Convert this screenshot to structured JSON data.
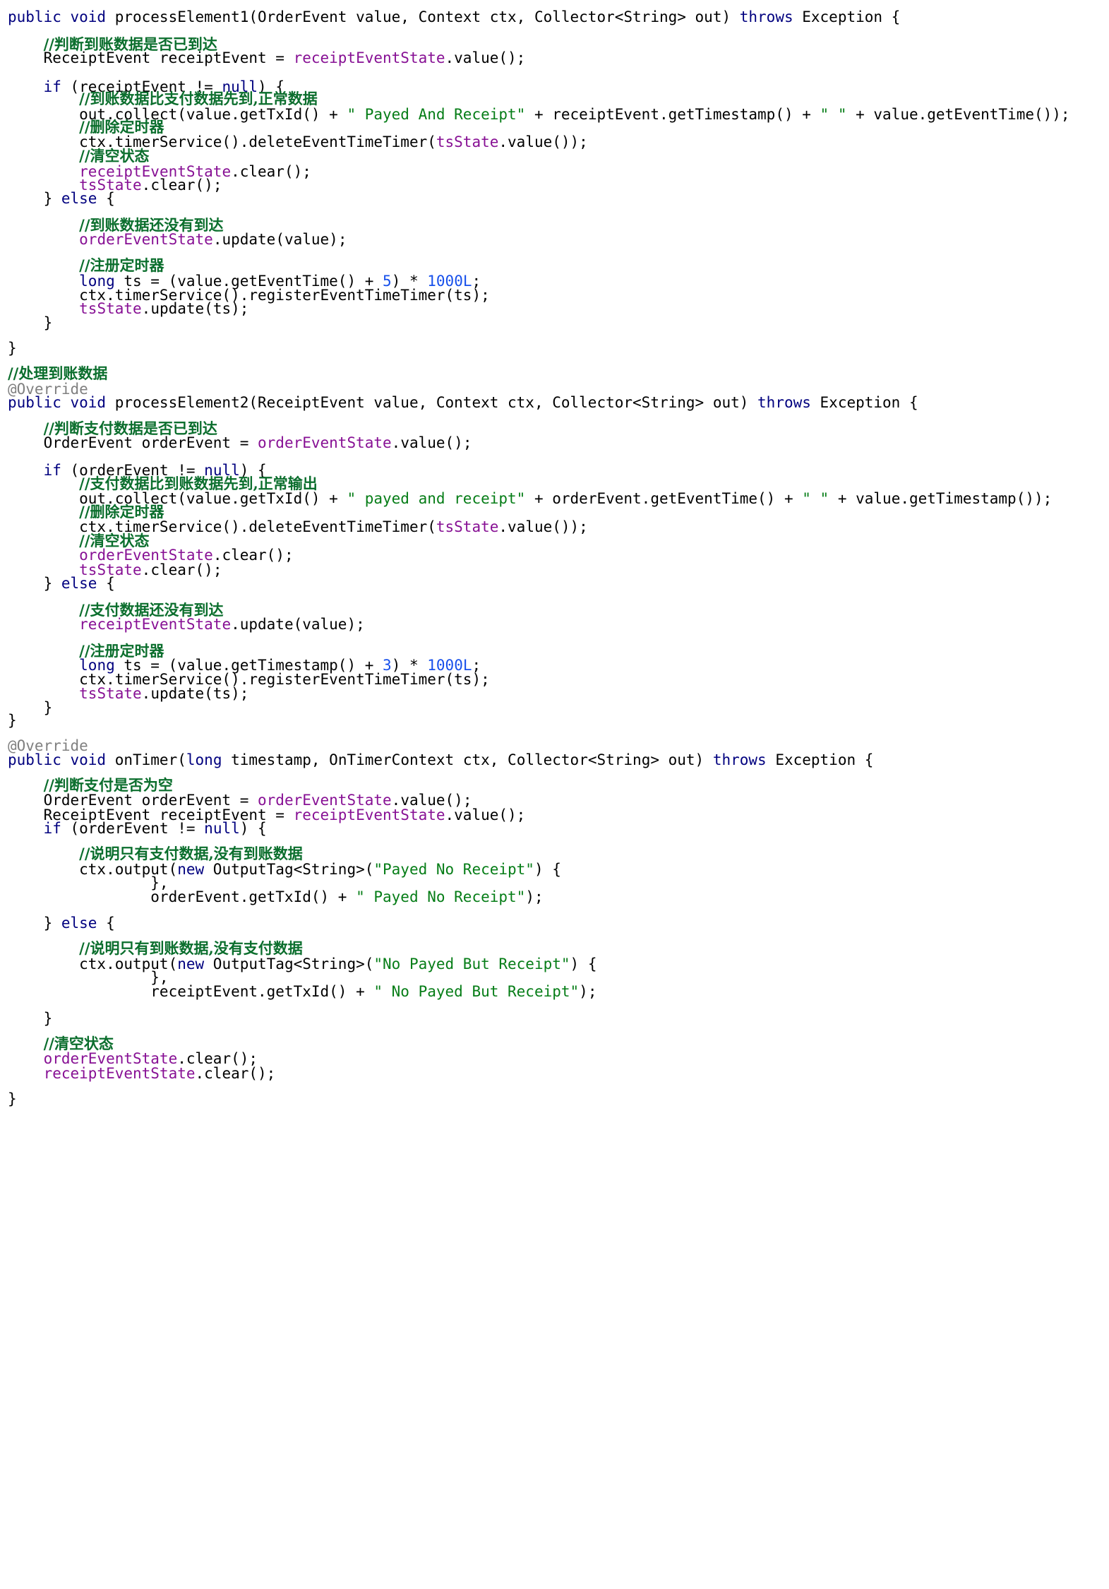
{
  "editor": {
    "palette": {
      "background": "#ffffff",
      "text": "#000000",
      "keyword": "#00007f",
      "literal": "#1750eb",
      "field": "#871094",
      "string": "#067d17",
      "comment": "#0b6e2d",
      "annotation": "#808080"
    },
    "lines": [
      [
        {
          "t": "public void ",
          "c": "kw"
        },
        {
          "t": "processElement1",
          "c": "fn"
        },
        {
          "t": "(OrderEvent value, Context ctx, Collector<String> out) "
        },
        {
          "t": "throws",
          "c": "kw"
        },
        {
          "t": " Exception {"
        }
      ],
      [
        {
          "t": "    "
        },
        {
          "t": "//判断到账数据是否已到达",
          "c": "cmt"
        }
      ],
      [
        {
          "t": "    ReceiptEvent receiptEvent = "
        },
        {
          "t": "receiptEventState",
          "c": "fld"
        },
        {
          "t": ".value();"
        }
      ],
      [
        {
          "t": "    "
        },
        {
          "t": "if",
          "c": "kw"
        },
        {
          "t": " (receiptEvent != "
        },
        {
          "t": "null",
          "c": "kw"
        },
        {
          "t": ") {"
        }
      ],
      [
        {
          "t": "        "
        },
        {
          "t": "//到账数据比支付数据先到,正常数据",
          "c": "cmt"
        }
      ],
      [
        {
          "t": "        out.collect(value.getTxId() + "
        },
        {
          "t": "\" Payed And Receipt\"",
          "c": "str"
        },
        {
          "t": " + receiptEvent.getTimestamp() + "
        },
        {
          "t": "\" \"",
          "c": "str"
        },
        {
          "t": " + value.getEventTime());"
        }
      ],
      [
        {
          "t": "        "
        },
        {
          "t": "//删除定时器",
          "c": "cmt"
        }
      ],
      [
        {
          "t": "        ctx.timerService().deleteEventTimeTimer("
        },
        {
          "t": "tsState",
          "c": "fld"
        },
        {
          "t": ".value());"
        }
      ],
      [
        {
          "t": "        "
        },
        {
          "t": "//清空状态",
          "c": "cmt"
        }
      ],
      [
        {
          "t": "        "
        },
        {
          "t": "receiptEventState",
          "c": "fld"
        },
        {
          "t": ".clear();"
        }
      ],
      [
        {
          "t": "        "
        },
        {
          "t": "tsState",
          "c": "fld"
        },
        {
          "t": ".clear();"
        }
      ],
      [
        {
          "t": "    } "
        },
        {
          "t": "else",
          "c": "kw"
        },
        {
          "t": " {"
        }
      ],
      [
        {
          "t": "        "
        },
        {
          "t": "//到账数据还没有到达",
          "c": "cmt"
        }
      ],
      [
        {
          "t": "        "
        },
        {
          "t": "orderEventState",
          "c": "fld"
        },
        {
          "t": ".update(value);"
        }
      ],
      [
        {
          "t": "        "
        },
        {
          "t": "//注册定时器",
          "c": "cmt"
        }
      ],
      [
        {
          "t": "        "
        },
        {
          "t": "long",
          "c": "kw"
        },
        {
          "t": " ts = (value.getEventTime() + "
        },
        {
          "t": "5",
          "c": "lit"
        },
        {
          "t": ") * "
        },
        {
          "t": "1000L",
          "c": "lit"
        },
        {
          "t": ";"
        }
      ],
      [
        {
          "t": "        ctx.timerService().registerEventTimeTimer(ts);"
        }
      ],
      [
        {
          "t": "        "
        },
        {
          "t": "tsState",
          "c": "fld"
        },
        {
          "t": ".update(ts);"
        }
      ],
      [
        {
          "t": "    }"
        }
      ],
      [
        {
          "t": "}"
        }
      ],
      [
        {
          "t": "//处理到账数据",
          "c": "cmt"
        }
      ],
      [
        {
          "t": "@Override",
          "c": "ann"
        }
      ],
      [
        {
          "t": "public void ",
          "c": "kw"
        },
        {
          "t": "processElement2",
          "c": "fn"
        },
        {
          "t": "(ReceiptEvent value, Context ctx, Collector<String> out) "
        },
        {
          "t": "throws",
          "c": "kw"
        },
        {
          "t": " Exception {"
        }
      ],
      [
        {
          "t": "    "
        },
        {
          "t": "//判断支付数据是否已到达",
          "c": "cmt"
        }
      ],
      [
        {
          "t": "    OrderEvent orderEvent = "
        },
        {
          "t": "orderEventState",
          "c": "fld"
        },
        {
          "t": ".value();"
        }
      ],
      [
        {
          "t": "    "
        },
        {
          "t": "if",
          "c": "kw"
        },
        {
          "t": " (orderEvent != "
        },
        {
          "t": "null",
          "c": "kw"
        },
        {
          "t": ") {"
        }
      ],
      [
        {
          "t": "        "
        },
        {
          "t": "//支付数据比到账数据先到,正常输出",
          "c": "cmt"
        }
      ],
      [
        {
          "t": "        out.collect(value.getTxId() + "
        },
        {
          "t": "\" payed and receipt\"",
          "c": "str"
        },
        {
          "t": " + orderEvent.getEventTime() + "
        },
        {
          "t": "\" \"",
          "c": "str"
        },
        {
          "t": " + value.getTimestamp());"
        }
      ],
      [
        {
          "t": "        "
        },
        {
          "t": "//删除定时器",
          "c": "cmt"
        }
      ],
      [
        {
          "t": "        ctx.timerService().deleteEventTimeTimer("
        },
        {
          "t": "tsState",
          "c": "fld"
        },
        {
          "t": ".value());"
        }
      ],
      [
        {
          "t": "        "
        },
        {
          "t": "//清空状态",
          "c": "cmt"
        }
      ],
      [
        {
          "t": "        "
        },
        {
          "t": "orderEventState",
          "c": "fld"
        },
        {
          "t": ".clear();"
        }
      ],
      [
        {
          "t": "        "
        },
        {
          "t": "tsState",
          "c": "fld"
        },
        {
          "t": ".clear();"
        }
      ],
      [
        {
          "t": "    } "
        },
        {
          "t": "else",
          "c": "kw"
        },
        {
          "t": " {"
        }
      ],
      [
        {
          "t": "        "
        },
        {
          "t": "//支付数据还没有到达",
          "c": "cmt"
        }
      ],
      [
        {
          "t": "        "
        },
        {
          "t": "receiptEventState",
          "c": "fld"
        },
        {
          "t": ".update(value);"
        }
      ],
      [
        {
          "t": "        "
        },
        {
          "t": "//注册定时器",
          "c": "cmt"
        }
      ],
      [
        {
          "t": "        "
        },
        {
          "t": "long",
          "c": "kw"
        },
        {
          "t": " ts = (value.getTimestamp() + "
        },
        {
          "t": "3",
          "c": "lit"
        },
        {
          "t": ") * "
        },
        {
          "t": "1000L",
          "c": "lit"
        },
        {
          "t": ";"
        }
      ],
      [
        {
          "t": "        ctx.timerService().registerEventTimeTimer(ts);"
        }
      ],
      [
        {
          "t": "        "
        },
        {
          "t": "tsState",
          "c": "fld"
        },
        {
          "t": ".update(ts);"
        }
      ],
      [
        {
          "t": "    }"
        }
      ],
      [
        {
          "t": "}"
        }
      ],
      [
        {
          "t": "@Override",
          "c": "ann"
        }
      ],
      [
        {
          "t": "public void ",
          "c": "kw"
        },
        {
          "t": "onTimer",
          "c": "fn"
        },
        {
          "t": "("
        },
        {
          "t": "long",
          "c": "kw"
        },
        {
          "t": " timestamp, OnTimerContext ctx, Collector<String> out) "
        },
        {
          "t": "throws",
          "c": "kw"
        },
        {
          "t": " Exception {"
        }
      ],
      [
        {
          "t": "    "
        },
        {
          "t": "//判断支付是否为空",
          "c": "cmt"
        }
      ],
      [
        {
          "t": "    OrderEvent orderEvent = "
        },
        {
          "t": "orderEventState",
          "c": "fld"
        },
        {
          "t": ".value();"
        }
      ],
      [
        {
          "t": "    ReceiptEvent receiptEvent = "
        },
        {
          "t": "receiptEventState",
          "c": "fld"
        },
        {
          "t": ".value();"
        }
      ],
      [
        {
          "t": "    "
        },
        {
          "t": "if",
          "c": "kw"
        },
        {
          "t": " (orderEvent != "
        },
        {
          "t": "null",
          "c": "kw"
        },
        {
          "t": ") {"
        }
      ],
      [
        {
          "t": "        "
        },
        {
          "t": "//说明只有支付数据,没有到账数据",
          "c": "cmt"
        }
      ],
      [
        {
          "t": "        ctx.output("
        },
        {
          "t": "new",
          "c": "kw"
        },
        {
          "t": " OutputTag<String>("
        },
        {
          "t": "\"Payed No Receipt\"",
          "c": "str"
        },
        {
          "t": ") {"
        }
      ],
      [
        {
          "t": "                },"
        }
      ],
      [
        {
          "t": "                orderEvent.getTxId() + "
        },
        {
          "t": "\" Payed No Receipt\"",
          "c": "str"
        },
        {
          "t": ");"
        }
      ],
      [
        {
          "t": "    } "
        },
        {
          "t": "else",
          "c": "kw"
        },
        {
          "t": " {"
        }
      ],
      [
        {
          "t": "        "
        },
        {
          "t": "//说明只有到账数据,没有支付数据",
          "c": "cmt"
        }
      ],
      [
        {
          "t": "        ctx.output("
        },
        {
          "t": "new",
          "c": "kw"
        },
        {
          "t": " OutputTag<String>("
        },
        {
          "t": "\"No Payed But Receipt\"",
          "c": "str"
        },
        {
          "t": ") {"
        }
      ],
      [
        {
          "t": "                },"
        }
      ],
      [
        {
          "t": "                receiptEvent.getTxId() + "
        },
        {
          "t": "\" No Payed But Receipt\"",
          "c": "str"
        },
        {
          "t": ");"
        }
      ],
      [
        {
          "t": "    }"
        }
      ],
      [
        {
          "t": "    "
        },
        {
          "t": "//清空状态",
          "c": "cmt"
        }
      ],
      [
        {
          "t": "    "
        },
        {
          "t": "orderEventState",
          "c": "fld"
        },
        {
          "t": ".clear();"
        }
      ],
      [
        {
          "t": "    "
        },
        {
          "t": "receiptEventState",
          "c": "fld"
        },
        {
          "t": ".clear();"
        }
      ],
      [
        {
          "t": "}"
        }
      ]
    ]
  }
}
